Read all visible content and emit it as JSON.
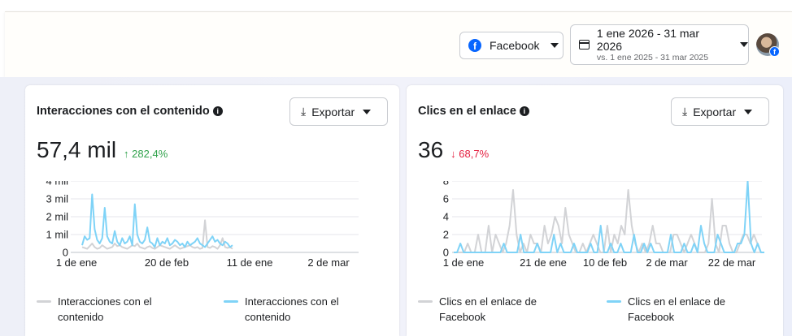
{
  "header": {
    "platform_label": "Facebook",
    "date_range": "1 ene 2026 - 31 mar 2026",
    "date_compare": "vs. 1 ene 2025 - 31 mar 2025"
  },
  "colors": {
    "brand": "#0866ff",
    "current_series": "#7fd3f7",
    "previous_series": "#d2d3d6",
    "increase": "#31a24c",
    "decrease": "#e41e3f"
  },
  "cards": [
    {
      "title": "Interacciones con el contenido",
      "export_label": "Exportar",
      "value": "57,4 mil",
      "change": "↑ 282,4%",
      "legend": [
        {
          "text": "Interacciones con el contenido",
          "color": "#d2d3d6"
        },
        {
          "text": "Interacciones con el contenido",
          "color": "#7fd3f7"
        }
      ]
    },
    {
      "title": "Clics en el enlace",
      "export_label": "Exportar",
      "value": "36",
      "change": "↓ 68,7%",
      "legend": [
        {
          "text": "Clics en el enlace de Facebook",
          "color": "#d2d3d6"
        },
        {
          "text": "Clics en el enlace de Facebook",
          "color": "#7fd3f7"
        }
      ]
    }
  ],
  "chart_data": [
    {
      "type": "line",
      "y_ticks": [
        "4 mil",
        "3 mil",
        "2 mil",
        "1 mil",
        "0"
      ],
      "x_ticks": [
        "1 de ene",
        "20 de feb",
        "11 de ene",
        "2 de mar"
      ],
      "ylim": [
        0,
        4000
      ],
      "grid": true,
      "series": [
        {
          "color": "#d2d3d6",
          "values": [
            300,
            250,
            200,
            350,
            500,
            300,
            200,
            250,
            400,
            300,
            200,
            250,
            300,
            500,
            350,
            400,
            300,
            250,
            200,
            300,
            400,
            350,
            500,
            300,
            250,
            200,
            300,
            350,
            250,
            200,
            300,
            400,
            350,
            300,
            250,
            200,
            300,
            400,
            300,
            200,
            250,
            300,
            350,
            400,
            300,
            250,
            300,
            200,
            250,
            1800,
            300,
            250,
            350,
            300,
            200,
            400,
            800,
            300,
            250,
            300,
            200
          ]
        },
        {
          "color": "#7fd3f7",
          "values": [
            400,
            900,
            700,
            800,
            3250,
            1300,
            700,
            500,
            800,
            2500,
            900,
            600,
            500,
            1200,
            600,
            400,
            800,
            500,
            600,
            900,
            400,
            2700,
            1000,
            600,
            500,
            700,
            1400,
            600,
            500,
            300,
            800,
            400,
            600,
            500,
            800,
            400,
            500,
            700,
            600,
            400,
            500,
            300,
            600,
            400,
            500,
            600,
            800,
            500,
            400,
            300,
            500,
            700,
            900,
            600,
            700,
            500,
            400,
            600,
            500,
            300,
            400
          ]
        }
      ]
    },
    {
      "type": "line",
      "y_ticks": [
        "8",
        "6",
        "4",
        "2",
        "0"
      ],
      "x_ticks": [
        "1 de ene",
        "21 de ene",
        "10 de feb",
        "2 de mar",
        "22 de mar"
      ],
      "ylim": [
        0,
        8
      ],
      "grid": true,
      "series": [
        {
          "color": "#d2d3d6",
          "values": [
            0,
            0,
            0,
            0,
            1,
            0,
            0,
            2,
            0,
            0,
            3,
            0,
            2,
            1,
            0,
            1,
            3,
            7,
            2,
            0,
            1,
            0,
            2,
            1,
            1,
            0,
            3,
            1,
            2,
            4,
            3,
            1,
            5,
            2,
            1,
            0,
            0,
            1,
            0,
            1,
            2,
            1,
            0,
            0,
            3,
            0,
            2,
            1,
            3,
            2,
            7,
            3,
            1,
            0,
            1,
            0,
            1,
            3,
            1,
            1,
            0,
            0,
            0,
            2,
            2,
            1,
            0,
            1,
            2,
            1,
            0,
            0,
            0,
            1,
            6,
            1,
            0,
            3,
            3,
            1,
            0,
            0,
            1,
            2,
            2,
            1,
            2,
            1,
            0,
            0
          ]
        },
        {
          "color": "#7fd3f7",
          "values": [
            0,
            0,
            1,
            0,
            0,
            0,
            0,
            0,
            0,
            0,
            0,
            0,
            0,
            0,
            0,
            1,
            0,
            0,
            0,
            0,
            2,
            0,
            0,
            0,
            0,
            1,
            0,
            0,
            0,
            0,
            2,
            0,
            1,
            0,
            0,
            0,
            1,
            0,
            0,
            0,
            0,
            1,
            0,
            0,
            3,
            0,
            0,
            1,
            0,
            0,
            1,
            0,
            0,
            0,
            2,
            0,
            0,
            1,
            0,
            1,
            0,
            0,
            0,
            0,
            0,
            2,
            0,
            0,
            0,
            1,
            0,
            0,
            1,
            0,
            3,
            1,
            0,
            0,
            0,
            2,
            1,
            0,
            0,
            0,
            0,
            1,
            1,
            2,
            8,
            1,
            0,
            1,
            0,
            0
          ]
        }
      ]
    }
  ]
}
